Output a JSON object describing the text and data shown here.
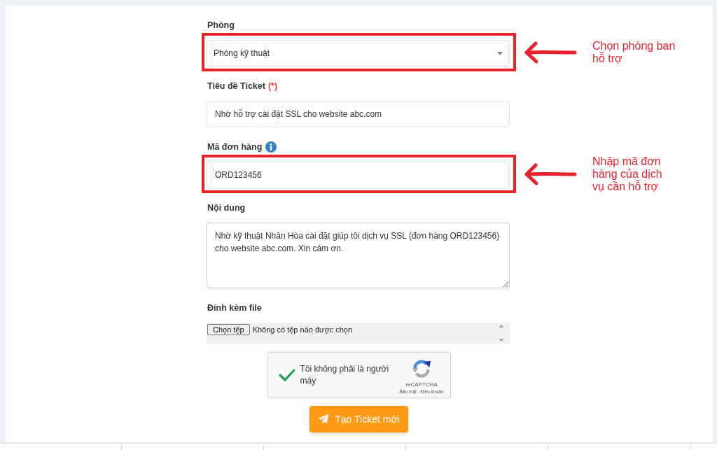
{
  "form": {
    "fields": [
      {
        "kind": "select",
        "label": "Phòng",
        "value": "Phòng kỹ thuật",
        "info": false,
        "highlighted": true,
        "annotation": "Chọn phòng ban hỗ trợ"
      },
      {
        "kind": "text",
        "label": "Tiêu đề Ticket",
        "required_mark": "(*)",
        "value": "Nhờ hỗ trợ cài đặt SSL cho website abc.com",
        "info": false,
        "highlighted": false
      },
      {
        "kind": "text",
        "label": "Mã đơn hàng",
        "value": "ORD123456",
        "info": true,
        "highlighted": true,
        "annotation": "Nhập mã đơn hàng của dịch vụ cần hỗ trợ"
      },
      {
        "kind": "textarea",
        "label": "Nội dung",
        "value": "Nhờ kỹ thuật Nhân Hòa cài đặt giúp tôi dịch vụ SSL (đơn hàng ORD123456) cho website abc.com. Xin cảm ơn.",
        "info": false,
        "highlighted": false
      },
      {
        "kind": "file",
        "label": "Đính kèm file",
        "button": "Chọn tệp",
        "status": "Không có tệp nào được chọn",
        "info": false,
        "highlighted": false
      }
    ],
    "captcha": {
      "checked": true,
      "label": "Tôi không phải là người máy",
      "brand": "reCAPTCHA",
      "links": "Bảo mật - Điều khoản"
    },
    "submit": {
      "label": "Tạo Ticket mới"
    }
  }
}
